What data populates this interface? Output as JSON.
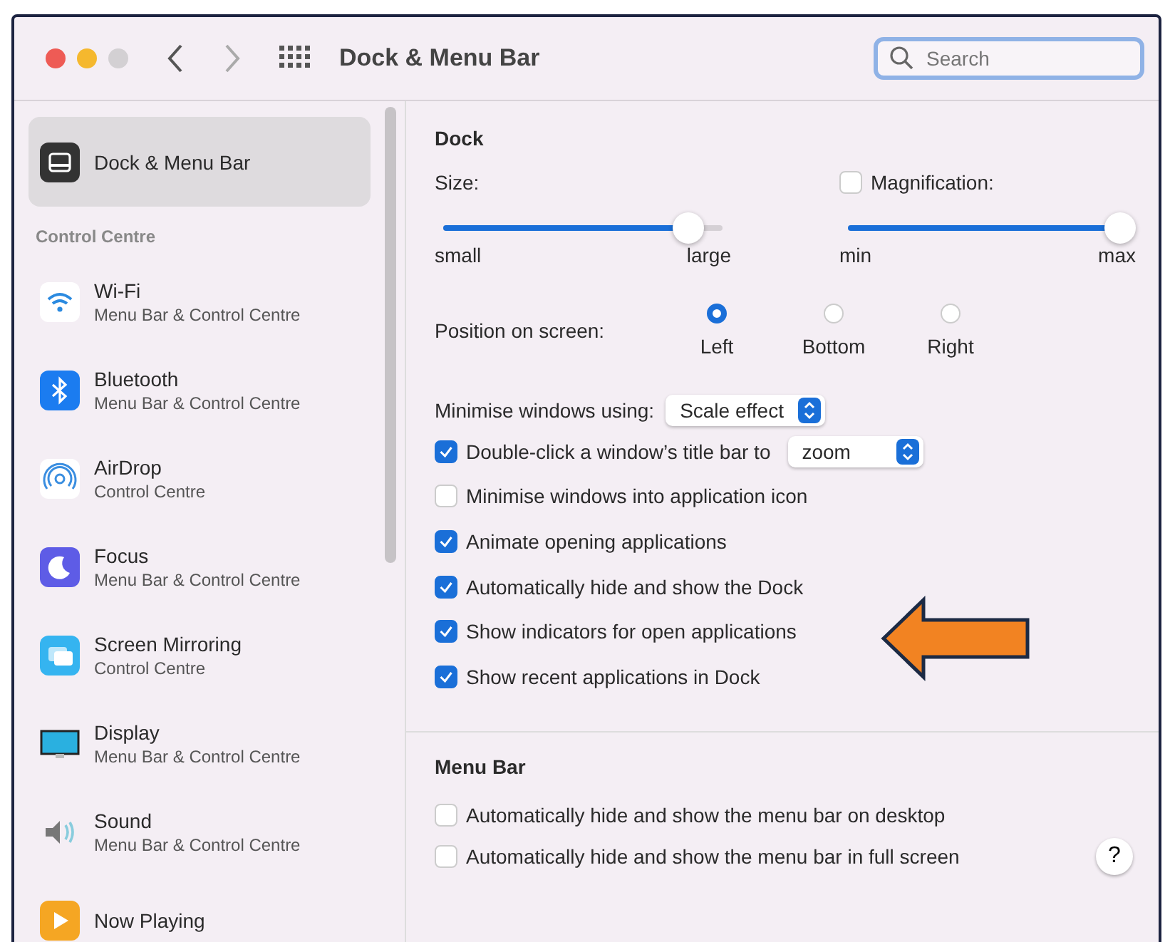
{
  "window": {
    "title": "Dock & Menu Bar",
    "search": {
      "placeholder": "Search"
    }
  },
  "sidebar": {
    "items": [
      {
        "kind": "dock",
        "title": "Dock & Menu Bar",
        "selected": true
      },
      {
        "kind": "header",
        "title": "Control Centre"
      },
      {
        "kind": "wifi",
        "title": "Wi-Fi",
        "subtitle": "Menu Bar & Control Centre",
        "selected": false
      },
      {
        "kind": "bluetooth",
        "title": "Bluetooth",
        "subtitle": "Menu Bar & Control Centre",
        "selected": false
      },
      {
        "kind": "airdrop",
        "title": "AirDrop",
        "subtitle": "Control Centre",
        "selected": false
      },
      {
        "kind": "focus",
        "title": "Focus",
        "subtitle": "Menu Bar & Control Centre",
        "selected": false
      },
      {
        "kind": "mirroring",
        "title": "Screen Mirroring",
        "subtitle": "Control Centre",
        "selected": false
      },
      {
        "kind": "display",
        "title": "Display",
        "subtitle": "Menu Bar & Control Centre",
        "selected": false
      },
      {
        "kind": "sound",
        "title": "Sound",
        "subtitle": "Menu Bar & Control Centre",
        "selected": false
      },
      {
        "kind": "playing",
        "title": "Now Playing",
        "selected": false
      }
    ]
  },
  "dock": {
    "heading": "Dock",
    "size": {
      "label": "Size:",
      "level": 0.9,
      "min": "small",
      "max": "large"
    },
    "magnification": {
      "label": "Magnification:",
      "checked": false,
      "level": 1,
      "min": "min",
      "max": "max"
    },
    "position": {
      "label": "Position on screen:",
      "options": [
        {
          "label": "Left",
          "selected": true
        },
        {
          "label": "Bottom",
          "selected": false
        },
        {
          "label": "Right",
          "selected": false
        }
      ]
    },
    "minimise": {
      "label": "Minimise windows using:",
      "value": "Scale effect"
    },
    "options": [
      {
        "label": "Double-click a window’s title bar to",
        "checked": true,
        "select": "zoom"
      },
      {
        "label": "Minimise windows into application icon",
        "checked": false
      },
      {
        "label": "Animate opening applications",
        "checked": true
      },
      {
        "label": "Automatically hide and show the Dock",
        "checked": true
      },
      {
        "label": "Show indicators for open applications",
        "checked": true
      },
      {
        "label": "Show recent applications in Dock",
        "checked": true
      }
    ]
  },
  "menu_bar": {
    "heading": "Menu Bar",
    "options": [
      {
        "label": "Automatically hide and show the menu bar on desktop",
        "checked": false
      },
      {
        "label": "Automatically hide and show the menu bar in full screen",
        "checked": false
      }
    ]
  },
  "help": "?"
}
